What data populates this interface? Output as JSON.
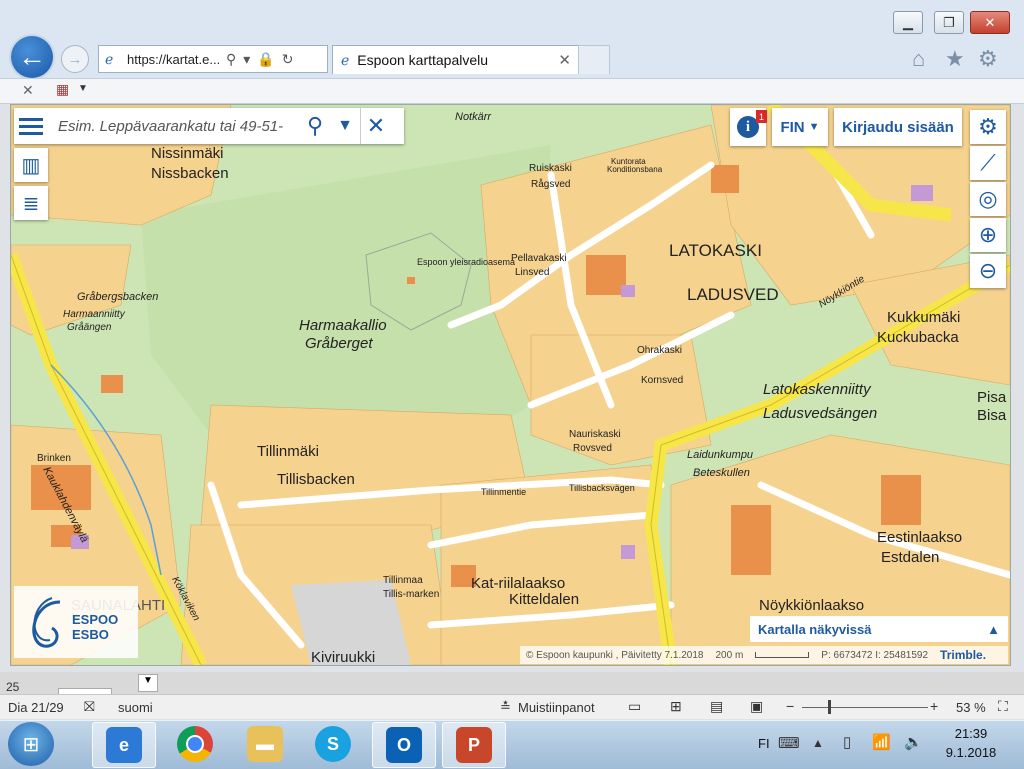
{
  "browser": {
    "address": "https://kartat.e...",
    "tab_title": "Espoon karttapalvelu",
    "tab_close": "✕"
  },
  "map": {
    "search_placeholder": "Esim. Leppävaarankatu tai 49-51-",
    "lang": "FIN",
    "login": "Kirjaudu sisään",
    "info_badge": "1",
    "logo_line1": "ESPOO",
    "logo_line2": "ESBO",
    "visible_panel": "Kartalla näkyvissä",
    "footer": {
      "copyright": "© Espoon kaupunki , Päivitetty 7.1.2018",
      "scale": "200 m",
      "coords": "P: 6673472 I: 25481592",
      "brand": "Trimble."
    },
    "places": {
      "nissinmaki": "Nissinmäki",
      "nissbacken": "Nissbacken",
      "harmaakallio": "Harmaakallio",
      "graberget": "Gråberget",
      "grabergsbacken": "Gråbergsbacken",
      "harmaanniitty": "Harmaanniitty",
      "graangen": "Gråängen",
      "tillinmaki": "Tillinmäki",
      "tillisbacken": "Tillisbacken",
      "latokaski": "LATOKASKI",
      "ladusved": "LADUSVED",
      "kukkumaki": "Kukkumäki",
      "kuckubacka": "Kuckubacka",
      "latokaskenniitty": "Latokaskenniitty",
      "ladusvedsangen": "Ladusvedsängen",
      "katriilalaakso": "Kat-riilalaakso",
      "kitteldalen": "Kitteldalen",
      "noykkionlaakso": "Nöykkiönlaakso",
      "eestinlaakso": "Eestinlaakso",
      "estdalen": "Estdalen",
      "kiviruukki": "Kiviruukki",
      "pisa": "Pisa",
      "bisa": "Bisa",
      "laidunkumpu": "Laidunkumpu",
      "beteskullen": "Beteskullen",
      "notkarri": "Notkärr",
      "ruiskaski": "Ruiskaski",
      "ragsved": "Rågsved",
      "pellavakaski": "Pellavakaski",
      "linsved": "Linsved",
      "ohrakaski": "Ohrakaski",
      "kornsved": "Kornsved",
      "nauriskaski": "Nauriskaski",
      "rovsved": "Rovsved",
      "noykkiontie": "Nöykkiöntie",
      "kauklahdenvayla": "Kauklahdenväylä",
      "tillinmentie": "Tillinmentie",
      "tillisbacksvagen": "Tillisbacksvägen",
      "kokuvayla": "Köklaviken",
      "tillimaa": "Tillinmaa",
      "tillismarken": "Tillis-marken",
      "espoon_radio": "Espoon yleisradioasema",
      "kuntorata": "Kuntorata",
      "konditionsbana": "Konditionsbana",
      "brinken": "Brinken",
      "saunalahti": "SAUNALAHTI"
    }
  },
  "ppt": {
    "slide_num": "25",
    "slide_info": "Dia 21/29",
    "language": "suomi",
    "notes": "Muistiinpanot",
    "zoom": "53 %"
  },
  "taskbar": {
    "lang": "FI",
    "time": "21:39",
    "date": "9.1.2018"
  }
}
